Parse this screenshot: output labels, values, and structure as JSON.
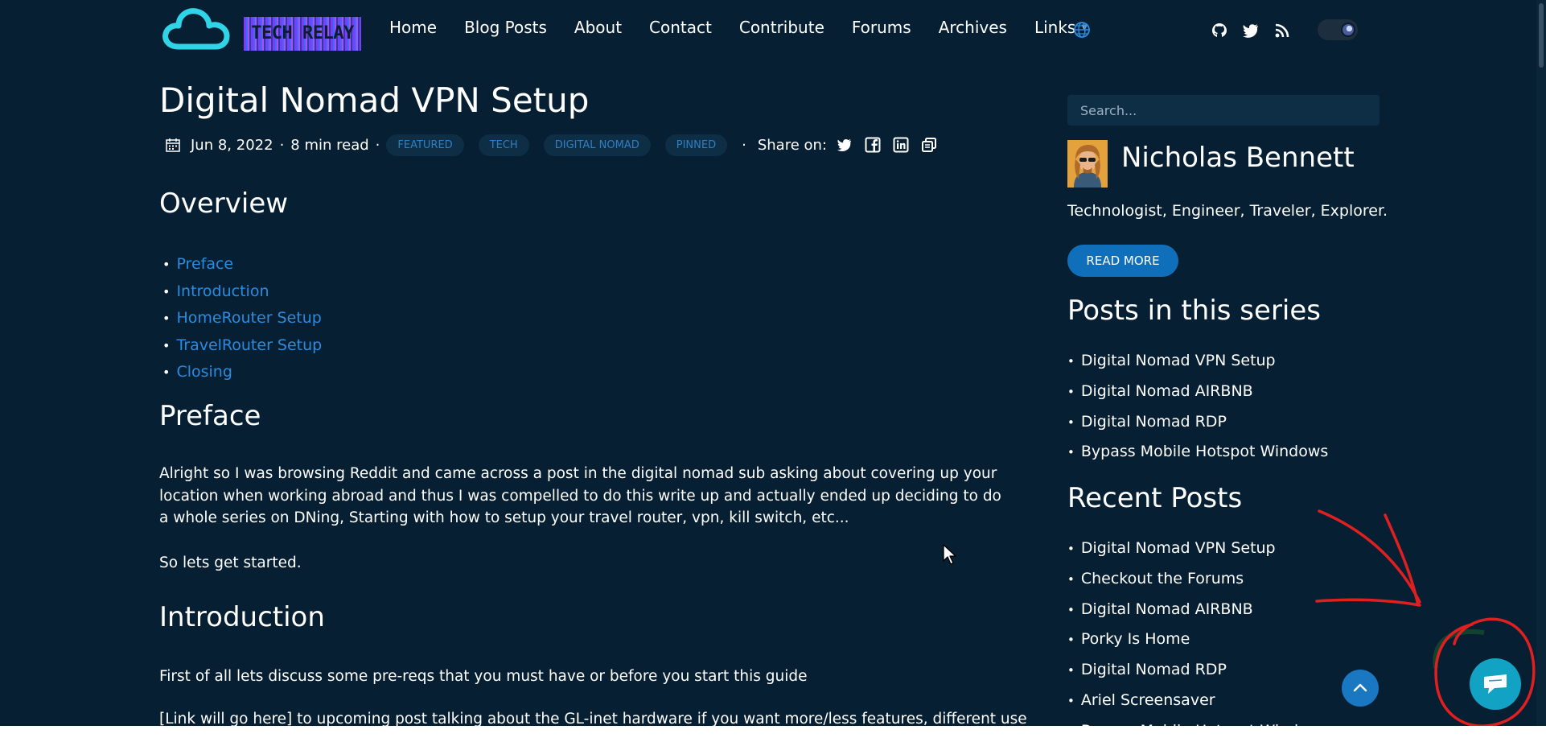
{
  "site": {
    "logo_text": "TECH RELAY",
    "nav": [
      "Home",
      "Blog Posts",
      "About",
      "Contact",
      "Contribute",
      "Forums",
      "Archives",
      "Links"
    ],
    "links_has_dropdown": true,
    "icons": [
      "globe-icon",
      "github-icon",
      "twitter-icon",
      "rss-icon"
    ],
    "theme_toggle": "dark"
  },
  "post": {
    "title": "Digital Nomad VPN Setup",
    "date": "Jun 8, 2022",
    "read_time": "8 min read",
    "tags": [
      "FEATURED",
      "TECH",
      "DIGITAL NOMAD",
      "PINNED"
    ],
    "share_label": "Share on:",
    "share_icons": [
      "twitter-icon",
      "facebook-icon",
      "linkedin-icon",
      "copy-icon"
    ],
    "overview_heading": "Overview",
    "toc": [
      "Preface",
      "Introduction",
      "HomeRouter Setup",
      "TravelRouter Setup",
      "Closing"
    ],
    "preface_heading": "Preface",
    "preface_p1": "Alright so I was browsing Reddit and came across a post in the digital nomad sub asking about covering up your location when working abroad and thus I was compelled to do this write up and actually ended up deciding to do a whole series on DNing, Starting with how to setup your travel router, vpn, kill switch, etc...",
    "preface_p2": "So lets get started.",
    "intro_heading": "Introduction",
    "intro_p1": "First of all lets discuss some pre-reqs that you must have or before you start this guide",
    "intro_p2": "[Link will go here] to upcoming post talking about the GL-inet hardware if you want more/less features, different use"
  },
  "sidebar": {
    "search_placeholder": "Search...",
    "author_name": "Nicholas Bennett",
    "tagline": "Technologist, Engineer, Traveler, Explorer.",
    "read_more": "READ MORE",
    "series_heading": "Posts in this series",
    "series": [
      "Digital Nomad VPN Setup",
      "Digital Nomad AIRBNB",
      "Digital Nomad RDP",
      "Bypass Mobile Hotspot Windows"
    ],
    "recent_heading": "Recent Posts",
    "recent": [
      "Digital Nomad VPN Setup",
      "Checkout the Forums",
      "Digital Nomad AIRBNB",
      "Porky Is Home",
      "Digital Nomad RDP",
      "Ariel Screensaver",
      "Bypass Mobile Hotspot Windows"
    ]
  },
  "colors": {
    "background": "#061f33",
    "link": "#2a8ce0",
    "tag_text": "#2d7fc4",
    "accent_button": "#0f6fba",
    "chat_button": "#12a3c4",
    "annotation": "#e02020"
  },
  "floating": {
    "scroll_top_icon": "chevron-up-icon",
    "chat_icon": "chat-bubble-icon"
  }
}
